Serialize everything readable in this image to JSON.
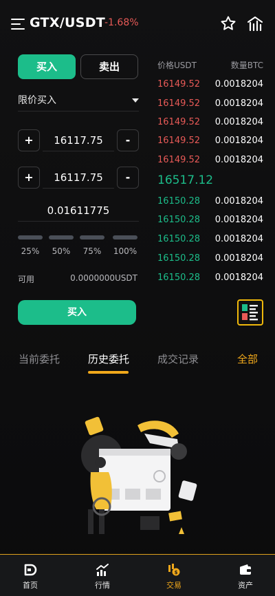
{
  "header": {
    "pair": "GTX/USDT",
    "change": "-1.68%"
  },
  "trade": {
    "buy_tab": "买入",
    "sell_tab": "卖出",
    "order_type": "限价买入",
    "price_value": "16117.75",
    "price2_value": "16117.75",
    "plus": "+",
    "minus": "-",
    "amount": "0.01611775",
    "percentages": [
      "25%",
      "50%",
      "75%",
      "100%"
    ],
    "available_label": "可用",
    "available_value": "0.0000000USDT",
    "submit": "买入"
  },
  "orderbook": {
    "price_header": "价格USDT",
    "qty_header": "数量BTC",
    "asks": [
      {
        "price": "16149.52",
        "qty": "0.0018204"
      },
      {
        "price": "16149.52",
        "qty": "0.0018204"
      },
      {
        "price": "16149.52",
        "qty": "0.0018204"
      },
      {
        "price": "16149.52",
        "qty": "0.0018204"
      },
      {
        "price": "16149.52",
        "qty": "0.0018204"
      }
    ],
    "last_price": "16517.12",
    "bids": [
      {
        "price": "16150.28",
        "qty": "0.0018204"
      },
      {
        "price": "16150.28",
        "qty": "0.0018204"
      },
      {
        "price": "16150.28",
        "qty": "0.0018204"
      },
      {
        "price": "16150.28",
        "qty": "0.0018204"
      },
      {
        "price": "16150.28",
        "qty": "0.0018204"
      }
    ]
  },
  "tabs": {
    "current": "当前委托",
    "history": "历史委托",
    "deals": "成交记录",
    "all": "全部"
  },
  "nav": {
    "home": "首页",
    "market": "行情",
    "trade": "交易",
    "assets": "资产"
  },
  "colors": {
    "green": "#1cbd8a",
    "red": "#e85a57",
    "accent": "#f0a81b"
  }
}
